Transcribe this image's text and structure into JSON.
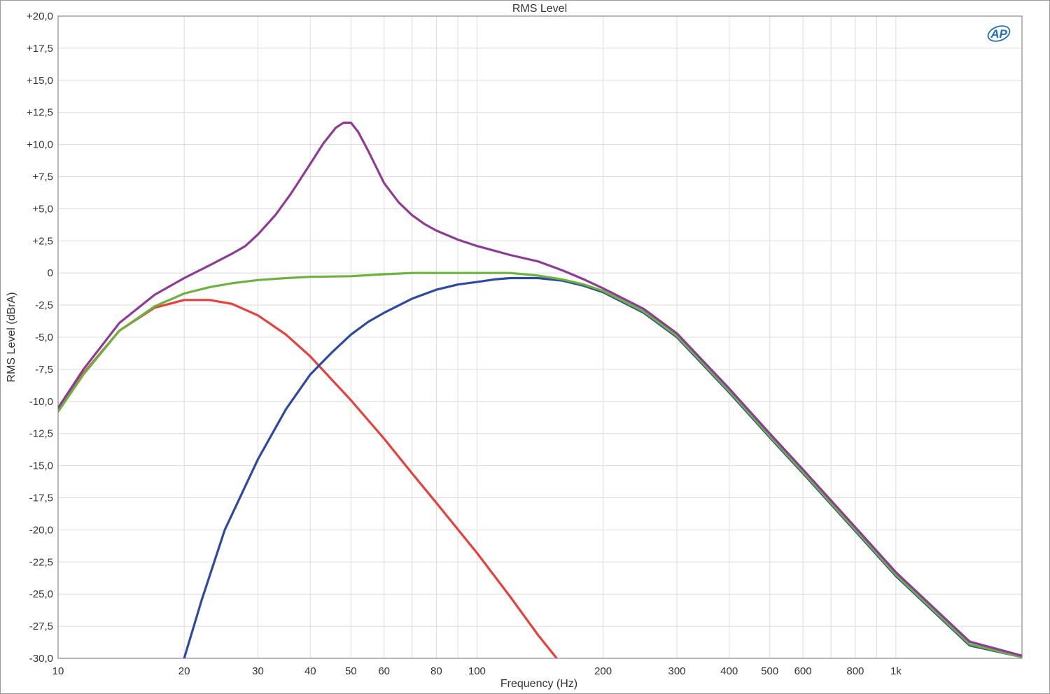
{
  "chart_data": {
    "type": "line",
    "title": "RMS Level",
    "xlabel": "Frequency (Hz)",
    "ylabel": "RMS Level (dBrA)",
    "xscale": "log",
    "xlim": [
      10,
      2000
    ],
    "ylim": [
      -30,
      20
    ],
    "grid": true,
    "logo": "AP",
    "x_ticks": [
      {
        "v": 10,
        "label": "10"
      },
      {
        "v": 20,
        "label": "20"
      },
      {
        "v": 30,
        "label": "30"
      },
      {
        "v": 40,
        "label": "40"
      },
      {
        "v": 50,
        "label": "50"
      },
      {
        "v": 60,
        "label": "60"
      },
      {
        "v": 80,
        "label": "80"
      },
      {
        "v": 100,
        "label": "100"
      },
      {
        "v": 200,
        "label": "200"
      },
      {
        "v": 300,
        "label": "300"
      },
      {
        "v": 400,
        "label": "400"
      },
      {
        "v": 500,
        "label": "500"
      },
      {
        "v": 600,
        "label": "600"
      },
      {
        "v": 800,
        "label": "800"
      },
      {
        "v": 1000,
        "label": "1k"
      }
    ],
    "y_ticks": [
      {
        "v": 20,
        "label": "+20,0"
      },
      {
        "v": 17.5,
        "label": "+17,5"
      },
      {
        "v": 15,
        "label": "+15,0"
      },
      {
        "v": 12.5,
        "label": "+12,5"
      },
      {
        "v": 10,
        "label": "+10,0"
      },
      {
        "v": 7.5,
        "label": "+7,5"
      },
      {
        "v": 5,
        "label": "+5,0"
      },
      {
        "v": 2.5,
        "label": "+2,5"
      },
      {
        "v": 0,
        "label": "0"
      },
      {
        "v": -2.5,
        "label": "-2,5"
      },
      {
        "v": -5,
        "label": "-5,0"
      },
      {
        "v": -7.5,
        "label": "-7,5"
      },
      {
        "v": -10,
        "label": "-10,0"
      },
      {
        "v": -12.5,
        "label": "-12,5"
      },
      {
        "v": -15,
        "label": "-15,0"
      },
      {
        "v": -17.5,
        "label": "-17,5"
      },
      {
        "v": -20,
        "label": "-20,0"
      },
      {
        "v": -22.5,
        "label": "-22,5"
      },
      {
        "v": -25,
        "label": "-25,0"
      },
      {
        "v": -27.5,
        "label": "-27,5"
      },
      {
        "v": -30,
        "label": "-30,0"
      }
    ],
    "series": [
      {
        "color": "#e8403a",
        "x": [
          10,
          11.5,
          14,
          17,
          20,
          23,
          26,
          30,
          35,
          40,
          45,
          50,
          60,
          70,
          80,
          100,
          120,
          140,
          155
        ],
        "y": [
          -10.5,
          -7.8,
          -4.5,
          -2.7,
          -2.1,
          -2.1,
          -2.4,
          -3.3,
          -4.8,
          -6.5,
          -8.3,
          -9.9,
          -12.9,
          -15.6,
          -17.9,
          -21.8,
          -25.2,
          -28.2,
          -30.0
        ]
      },
      {
        "color": "#2e4aa0",
        "x": [
          20,
          22,
          25,
          30,
          35,
          40,
          45,
          50,
          55,
          60,
          70,
          80,
          90,
          100,
          110,
          120,
          140,
          160,
          180,
          200,
          250,
          300,
          400,
          500,
          600,
          800,
          1000,
          1500,
          2000
        ],
        "y": [
          -30.0,
          -25.5,
          -20.0,
          -14.5,
          -10.6,
          -7.9,
          -6.2,
          -4.8,
          -3.8,
          -3.1,
          -2.0,
          -1.3,
          -0.9,
          -0.7,
          -0.5,
          -0.4,
          -0.4,
          -0.6,
          -1.0,
          -1.5,
          -3.1,
          -5.0,
          -9.3,
          -12.8,
          -15.6,
          -20.1,
          -23.6,
          -29.0,
          -29.9
        ]
      },
      {
        "color": "#6cb33e",
        "x": [
          10,
          11.5,
          14,
          17,
          20,
          23,
          26,
          30,
          35,
          40,
          50,
          60,
          70,
          80,
          100,
          120,
          140,
          160,
          180,
          200,
          250,
          300,
          400,
          500,
          600,
          800,
          1000,
          1500,
          2000
        ],
        "y": [
          -10.8,
          -7.9,
          -4.5,
          -2.6,
          -1.6,
          -1.1,
          -0.8,
          -0.55,
          -0.4,
          -0.3,
          -0.25,
          -0.1,
          0.0,
          0.0,
          0.0,
          0.0,
          -0.2,
          -0.5,
          -0.9,
          -1.4,
          -3.0,
          -4.9,
          -9.2,
          -12.7,
          -15.5,
          -20.0,
          -23.5,
          -28.9,
          -29.9
        ]
      },
      {
        "color": "#8e3b96",
        "x": [
          10,
          11.5,
          14,
          17,
          20,
          23,
          26,
          28,
          30,
          33,
          36,
          40,
          43,
          46,
          48,
          50,
          52,
          55,
          60,
          65,
          70,
          75,
          80,
          90,
          100,
          120,
          140,
          160,
          180,
          200,
          250,
          300,
          400,
          500,
          600,
          800,
          1000,
          1500,
          2000
        ],
        "y": [
          -10.5,
          -7.5,
          -3.9,
          -1.7,
          -0.4,
          0.6,
          1.5,
          2.1,
          3.0,
          4.5,
          6.2,
          8.5,
          10.1,
          11.3,
          11.7,
          11.7,
          11.0,
          9.5,
          7.0,
          5.5,
          4.5,
          3.8,
          3.3,
          2.6,
          2.1,
          1.4,
          0.9,
          0.2,
          -0.5,
          -1.2,
          -2.8,
          -4.7,
          -9.0,
          -12.5,
          -15.3,
          -19.8,
          -23.3,
          -28.7,
          -29.8
        ]
      }
    ]
  }
}
